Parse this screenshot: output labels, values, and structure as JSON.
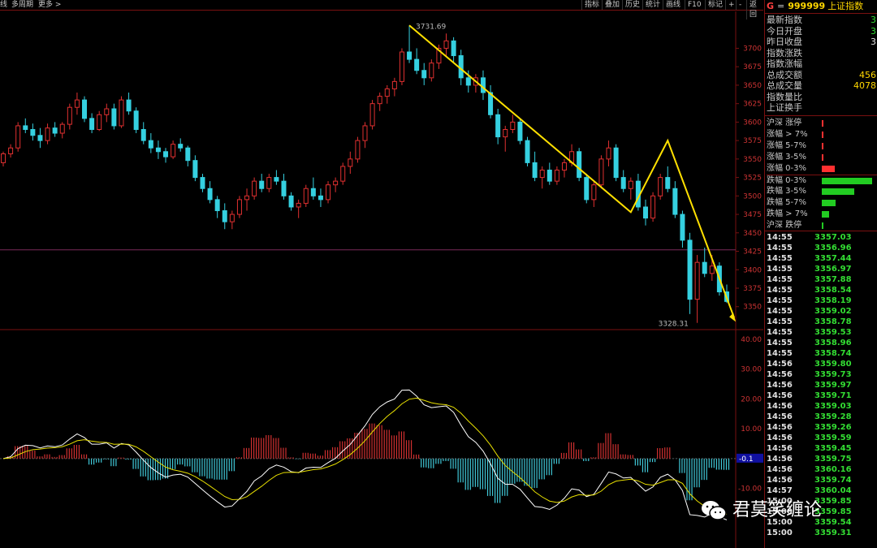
{
  "topbar": {
    "left_labels": [
      "线",
      "多周期",
      "更多 >"
    ],
    "buttons": [
      "指标",
      "叠加",
      "历史",
      "统计",
      "画线",
      "F10",
      "标记",
      "+",
      "-",
      "返回"
    ]
  },
  "chart_data": {
    "type": "candlestick",
    "price_axis": {
      "ticks": [
        3700,
        3675,
        3650,
        3625,
        3600,
        3575,
        3550,
        3525,
        3500,
        3475,
        3450,
        3425,
        3400,
        3375,
        3350
      ],
      "range": [
        3320,
        3750
      ]
    },
    "macd_axis": {
      "ticks": [
        "40.00",
        "30.00",
        "20.00",
        "10.00",
        "-10.00"
      ],
      "range": [
        -30,
        43
      ]
    },
    "high_label": "3731.69",
    "low_label": "3328.31",
    "zero_label": "-0.1",
    "reference_price": 3427,
    "trend_lines": [
      {
        "color": "#ffd700",
        "points": [
          [
            69,
            3731
          ],
          [
            94,
            3485
          ],
          [
            100,
            3577
          ],
          [
            120,
            3348
          ]
        ]
      },
      {
        "color": "#ffd700",
        "points": [
          [
            69,
            3731
          ],
          [
            94,
            3485
          ]
        ]
      }
    ],
    "candles": [
      [
        0,
        3545,
        3560,
        3540,
        3557
      ],
      [
        1,
        3557,
        3570,
        3552,
        3565
      ],
      [
        2,
        3565,
        3600,
        3560,
        3595
      ],
      [
        3,
        3595,
        3605,
        3585,
        3590
      ],
      [
        4,
        3590,
        3598,
        3575,
        3582
      ],
      [
        5,
        3582,
        3592,
        3565,
        3575
      ],
      [
        6,
        3575,
        3598,
        3570,
        3592
      ],
      [
        7,
        3592,
        3600,
        3580,
        3585
      ],
      [
        8,
        3585,
        3600,
        3578,
        3597
      ],
      [
        9,
        3597,
        3625,
        3590,
        3620
      ],
      [
        10,
        3620,
        3640,
        3610,
        3630
      ],
      [
        11,
        3630,
        3635,
        3600,
        3605
      ],
      [
        12,
        3605,
        3612,
        3585,
        3590
      ],
      [
        13,
        3590,
        3615,
        3588,
        3610
      ],
      [
        14,
        3610,
        3625,
        3600,
        3618
      ],
      [
        15,
        3618,
        3625,
        3590,
        3595
      ],
      [
        16,
        3595,
        3635,
        3592,
        3630
      ],
      [
        17,
        3630,
        3640,
        3610,
        3615
      ],
      [
        18,
        3615,
        3620,
        3585,
        3590
      ],
      [
        19,
        3590,
        3600,
        3570,
        3575
      ],
      [
        20,
        3575,
        3585,
        3558,
        3565
      ],
      [
        21,
        3565,
        3575,
        3550,
        3560
      ],
      [
        22,
        3560,
        3565,
        3545,
        3553
      ],
      [
        23,
        3553,
        3575,
        3550,
        3570
      ],
      [
        24,
        3570,
        3578,
        3560,
        3565
      ],
      [
        25,
        3565,
        3568,
        3540,
        3548
      ],
      [
        26,
        3548,
        3555,
        3520,
        3525
      ],
      [
        27,
        3525,
        3530,
        3505,
        3510
      ],
      [
        28,
        3510,
        3520,
        3490,
        3495
      ],
      [
        29,
        3495,
        3500,
        3470,
        3480
      ],
      [
        30,
        3480,
        3490,
        3455,
        3465
      ],
      [
        31,
        3465,
        3480,
        3455,
        3475
      ],
      [
        32,
        3475,
        3500,
        3470,
        3495
      ],
      [
        33,
        3495,
        3510,
        3480,
        3500
      ],
      [
        34,
        3500,
        3525,
        3495,
        3520
      ],
      [
        35,
        3520,
        3530,
        3505,
        3510
      ],
      [
        36,
        3510,
        3530,
        3505,
        3525
      ],
      [
        37,
        3525,
        3535,
        3515,
        3520
      ],
      [
        38,
        3520,
        3530,
        3495,
        3500
      ],
      [
        39,
        3500,
        3505,
        3480,
        3485
      ],
      [
        40,
        3485,
        3495,
        3470,
        3490
      ],
      [
        41,
        3490,
        3515,
        3485,
        3510
      ],
      [
        42,
        3510,
        3525,
        3495,
        3500
      ],
      [
        43,
        3500,
        3510,
        3485,
        3495
      ],
      [
        44,
        3495,
        3520,
        3490,
        3515
      ],
      [
        45,
        3515,
        3525,
        3505,
        3520
      ],
      [
        46,
        3520,
        3545,
        3515,
        3540
      ],
      [
        47,
        3540,
        3560,
        3530,
        3550
      ],
      [
        48,
        3550,
        3580,
        3545,
        3575
      ],
      [
        49,
        3575,
        3600,
        3565,
        3595
      ],
      [
        50,
        3595,
        3630,
        3590,
        3625
      ],
      [
        51,
        3625,
        3640,
        3615,
        3635
      ],
      [
        52,
        3635,
        3650,
        3625,
        3645
      ],
      [
        53,
        3645,
        3660,
        3635,
        3655
      ],
      [
        54,
        3655,
        3700,
        3650,
        3695
      ],
      [
        55,
        3695,
        3731,
        3680,
        3685
      ],
      [
        56,
        3685,
        3700,
        3665,
        3670
      ],
      [
        57,
        3670,
        3680,
        3650,
        3660
      ],
      [
        58,
        3660,
        3685,
        3655,
        3680
      ],
      [
        59,
        3680,
        3705,
        3672,
        3700
      ],
      [
        60,
        3700,
        3720,
        3690,
        3710
      ],
      [
        61,
        3710,
        3715,
        3680,
        3690
      ],
      [
        62,
        3690,
        3698,
        3650,
        3660
      ],
      [
        63,
        3660,
        3670,
        3640,
        3650
      ],
      [
        64,
        3650,
        3665,
        3640,
        3660
      ],
      [
        65,
        3660,
        3670,
        3630,
        3640
      ],
      [
        66,
        3640,
        3650,
        3605,
        3610
      ],
      [
        67,
        3610,
        3618,
        3570,
        3580
      ],
      [
        68,
        3580,
        3595,
        3560,
        3590
      ],
      [
        69,
        3590,
        3610,
        3585,
        3600
      ],
      [
        70,
        3600,
        3605,
        3570,
        3575
      ],
      [
        71,
        3575,
        3580,
        3540,
        3545
      ],
      [
        72,
        3545,
        3560,
        3520,
        3525
      ],
      [
        73,
        3525,
        3540,
        3510,
        3535
      ],
      [
        74,
        3535,
        3545,
        3515,
        3520
      ],
      [
        75,
        3520,
        3540,
        3515,
        3535
      ],
      [
        76,
        3535,
        3550,
        3525,
        3545
      ],
      [
        77,
        3545,
        3570,
        3540,
        3560
      ],
      [
        78,
        3560,
        3565,
        3520,
        3525
      ],
      [
        79,
        3525,
        3530,
        3490,
        3495
      ],
      [
        80,
        3495,
        3520,
        3485,
        3515
      ],
      [
        81,
        3515,
        3555,
        3510,
        3550
      ],
      [
        82,
        3550,
        3575,
        3540,
        3565
      ],
      [
        83,
        3565,
        3570,
        3520,
        3525
      ],
      [
        84,
        3525,
        3535,
        3505,
        3510
      ],
      [
        85,
        3510,
        3525,
        3495,
        3520
      ],
      [
        86,
        3520,
        3530,
        3480,
        3485
      ],
      [
        87,
        3485,
        3495,
        3460,
        3470
      ],
      [
        88,
        3470,
        3505,
        3465,
        3500
      ],
      [
        89,
        3500,
        3530,
        3495,
        3525
      ],
      [
        90,
        3525,
        3540,
        3505,
        3510
      ],
      [
        91,
        3510,
        3520,
        3470,
        3475
      ],
      [
        92,
        3475,
        3480,
        3430,
        3440
      ],
      [
        93,
        3440,
        3450,
        3340,
        3360
      ],
      [
        94,
        3360,
        3420,
        3328,
        3410
      ],
      [
        95,
        3410,
        3430,
        3390,
        3395
      ],
      [
        96,
        3395,
        3420,
        3385,
        3405
      ],
      [
        97,
        3405,
        3410,
        3365,
        3370
      ],
      [
        98,
        3370,
        3380,
        3355,
        3357
      ]
    ]
  },
  "panel": {
    "title_marker": "G",
    "title_eq": "=",
    "code": "999999",
    "name": "上证指数",
    "info_rows": [
      {
        "label": "最新指数",
        "value": "3",
        "color": "#33dd33"
      },
      {
        "label": "今日开盘",
        "value": "3",
        "color": "#33dd33"
      },
      {
        "label": "昨日收盘",
        "value": "3",
        "color": "#e0e0e0"
      },
      {
        "label": "指数涨跌",
        "value": "",
        "color": "#33dd33"
      },
      {
        "label": "指数涨幅",
        "value": "",
        "color": "#33dd33"
      },
      {
        "label": "总成交额",
        "value": "456",
        "color": "#ffd700"
      },
      {
        "label": "总成交量",
        "value": "4078",
        "color": "#ffd700"
      },
      {
        "label": "指数量比",
        "value": "",
        "color": "#e0e0e0"
      },
      {
        "label": "上证换手",
        "value": "",
        "color": "#e0e0e0"
      }
    ],
    "dist_rows": [
      {
        "label": "沪深 涨停",
        "frac": 0.02,
        "color": "#ff3030"
      },
      {
        "label": "涨幅 > 7%",
        "frac": 0.02,
        "color": "#ff3030"
      },
      {
        "label": "涨幅 5-7%",
        "frac": 0.01,
        "color": "#ff3030"
      },
      {
        "label": "涨幅 3-5%",
        "frac": 0.03,
        "color": "#ff3030"
      },
      {
        "label": "涨幅 0-3%",
        "frac": 0.25,
        "color": "#ff3030"
      },
      {
        "label": "跌幅 0-3%",
        "frac": 1.0,
        "color": "#22cc22"
      },
      {
        "label": "跌幅 3-5%",
        "frac": 0.65,
        "color": "#22cc22"
      },
      {
        "label": "跌幅 5-7%",
        "frac": 0.28,
        "color": "#22cc22"
      },
      {
        "label": "跌幅 > 7%",
        "frac": 0.15,
        "color": "#22cc22"
      },
      {
        "label": "沪深 跌停",
        "frac": 0.04,
        "color": "#22cc22"
      }
    ],
    "ticks": [
      [
        "14:55",
        "3357.03"
      ],
      [
        "14:55",
        "3356.96"
      ],
      [
        "14:55",
        "3357.44"
      ],
      [
        "14:55",
        "3356.97"
      ],
      [
        "14:55",
        "3357.88"
      ],
      [
        "14:55",
        "3358.54"
      ],
      [
        "14:55",
        "3358.19"
      ],
      [
        "14:55",
        "3359.02"
      ],
      [
        "14:55",
        "3358.78"
      ],
      [
        "14:55",
        "3359.53"
      ],
      [
        "14:55",
        "3358.96"
      ],
      [
        "14:55",
        "3358.74"
      ],
      [
        "14:56",
        "3359.80"
      ],
      [
        "14:56",
        "3359.73"
      ],
      [
        "14:56",
        "3359.97"
      ],
      [
        "14:56",
        "3359.71"
      ],
      [
        "14:56",
        "3359.03"
      ],
      [
        "14:56",
        "3359.28"
      ],
      [
        "14:56",
        "3359.26"
      ],
      [
        "14:56",
        "3359.59"
      ],
      [
        "14:56",
        "3359.45"
      ],
      [
        "14:56",
        "3359.75"
      ],
      [
        "14:56",
        "3360.16"
      ],
      [
        "14:56",
        "3359.74"
      ],
      [
        "14:57",
        "3360.04"
      ],
      [
        "15:00",
        "3359.85"
      ],
      [
        "15:00",
        "3359.85"
      ],
      [
        "15:00",
        "3359.54"
      ],
      [
        "15:00",
        "3359.31"
      ]
    ]
  },
  "watermark": {
    "text": "君莫笑缠论",
    "icon": "wechat-icon"
  }
}
